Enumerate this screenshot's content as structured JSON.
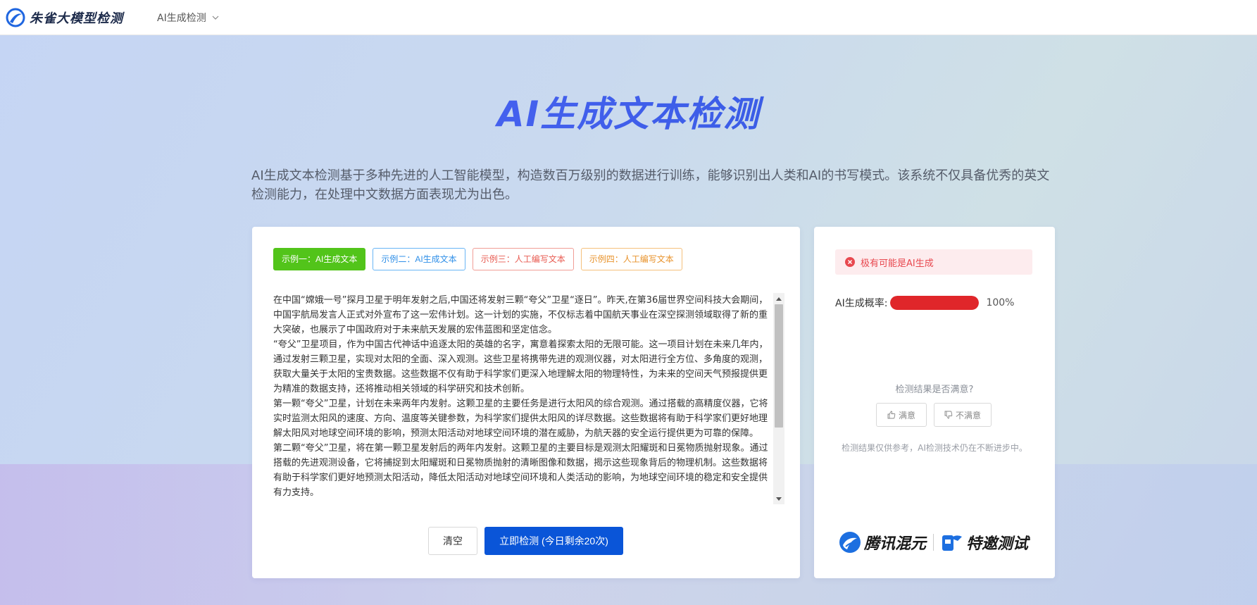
{
  "header": {
    "logo_text": "朱雀大模型检测",
    "nav_menu_label": "AI生成检测"
  },
  "hero": {
    "title": "AI生成文本检测",
    "intro": "AI生成文本检测基于多种先进的人工智能模型，构造数百万级别的数据进行训练，能够识别出人类和AI的书写模式。该系统不仅具备优秀的英文检测能力，在处理中文数据方面表现尤为出色。"
  },
  "examples": [
    {
      "label": "示例一：AI生成文本"
    },
    {
      "label": "示例二：AI生成文本"
    },
    {
      "label": "示例三：人工编写文本"
    },
    {
      "label": "示例四：人工编写文本"
    }
  ],
  "textbox": {
    "paragraphs": [
      "在中国“嫦娥一号”探月卫星于明年发射之后,中国还将发射三颗“夸父”卫星“逐日”。昨天,在第36届世界空间科技大会期间，中国宇航局发言人正式对外宣布了这一宏伟计划。这一计划的实施，不仅标志着中国航天事业在深空探测领域取得了新的重大突破，也展示了中国政府对于未来航天发展的宏伟蓝图和坚定信念。",
      "“夸父”卫星项目，作为中国古代神话中追逐太阳的英雄的名字，寓意着探索太阳的无限可能。这一项目计划在未来几年内，通过发射三颗卫星，实现对太阳的全面、深入观测。这些卫星将携带先进的观测仪器，对太阳进行全方位、多角度的观测，获取大量关于太阳的宝贵数据。这些数据不仅有助于科学家们更深入地理解太阳的物理特性，为未来的空间天气预报提供更为精准的数据支持，还将推动相关领域的科学研究和技术创新。",
      "第一颗“夸父”卫星，计划在未来两年内发射。这颗卫星的主要任务是进行太阳风的综合观测。通过搭载的高精度仪器，它将实时监测太阳风的速度、方向、温度等关键参数，为科学家们提供太阳风的详尽数据。这些数据将有助于科学家们更好地理解太阳风对地球空间环境的影响，预测太阳活动对地球空间环境的潜在威胁，为航天器的安全运行提供更为可靠的保障。",
      "第二颗“夸父”卫星，将在第一颗卫星发射后的两年内发射。这颗卫星的主要目标是观测太阳耀斑和日冕物质抛射现象。通过搭载的先进观测设备，它将捕捉到太阳耀斑和日冕物质抛射的清晰图像和数据，揭示这些现象背后的物理机制。这些数据将有助于科学家们更好地预测太阳活动，降低太阳活动对地球空间环境和人类活动的影响，为地球空间环境的稳定和安全提供有力支持。"
    ]
  },
  "actions": {
    "clear_label": "清空",
    "detect_label": "立即检测 (今日剩余20次)"
  },
  "result": {
    "alert_text": "极有可能是AI生成",
    "prob_label": "AI生成概率:",
    "prob_value": 1.0,
    "prob_text": "100%",
    "satisfy_question": "检测结果是否满意?",
    "like_label": "满意",
    "dislike_label": "不满意",
    "disclaimer": "检测结果仅供参考，AI检测技术仍在不断进步中。"
  },
  "brands": {
    "brand1": "腾讯混元",
    "brand2": "特邀测试"
  },
  "colors": {
    "accent": "#0a55d8",
    "success": "#52c41a",
    "danger": "#e0262a"
  }
}
